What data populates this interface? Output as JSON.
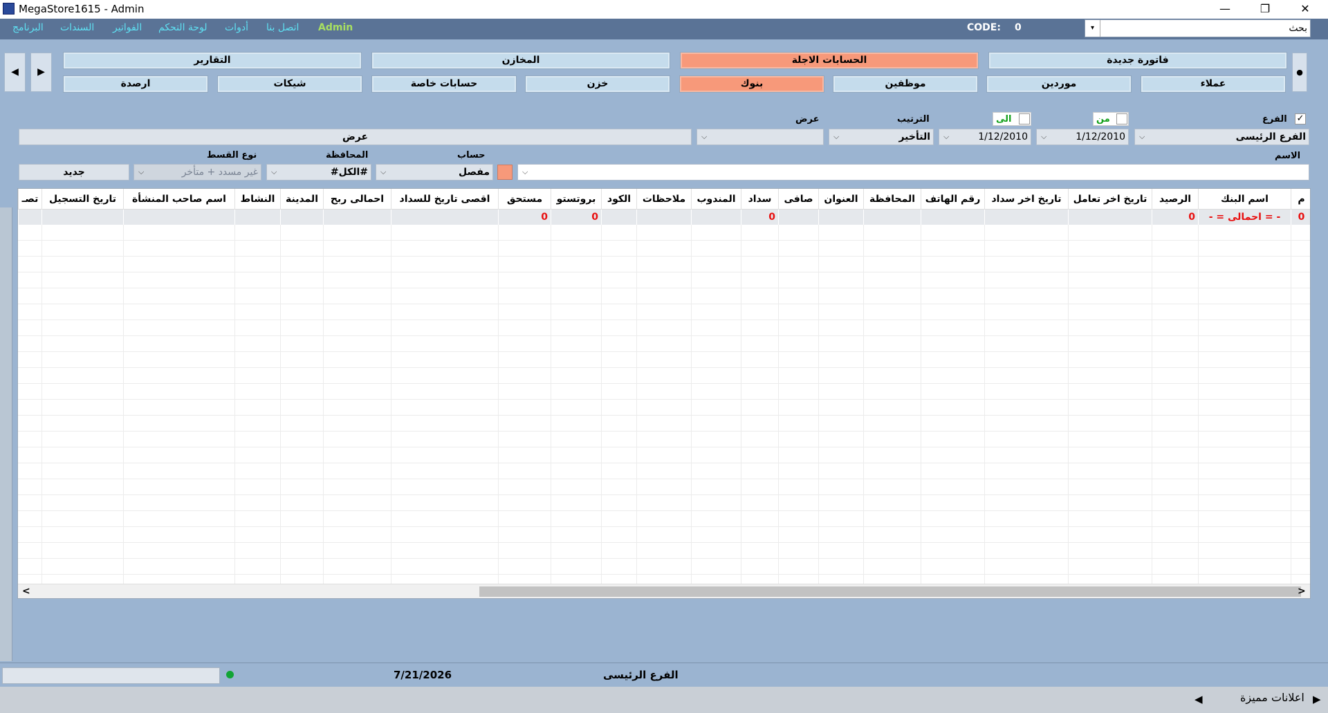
{
  "window": {
    "title": "MegaStore1615 - Admin",
    "min": "—",
    "restore": "❐",
    "close": "✕"
  },
  "menu": [
    "البرنامج",
    "السندات",
    "الفواتير",
    "لوحة التحكم",
    "أدوات",
    "اتصل بنا",
    "Admin"
  ],
  "code": {
    "label": "CODE:",
    "value": "0"
  },
  "search": {
    "text": "بحث",
    "arrow": "▾"
  },
  "nav": {
    "prev": "◀",
    "next": "▶",
    "dot": "●",
    "row1": [
      "فاتورة جديدة",
      "الحسابات الاجلة",
      "المخازن",
      "التقارير"
    ],
    "row2": [
      "عملاء",
      "موردين",
      "موظفين",
      "بنوك",
      "خزن",
      "حسابات خاصة",
      "شيكات",
      "ارصدة"
    ]
  },
  "filters": {
    "branch_label": "الفرع",
    "branch_checked": "✓",
    "branch_value": "الفرع الرئيسى",
    "from_label": "من",
    "to_label": "الى",
    "from_date": "1/12/2010",
    "to_date": "1/12/2010",
    "sort_label": "الترتيب",
    "sort_value": "التأخير",
    "view_label": "عرض",
    "view_button": "عرض",
    "name_label": "الاسم",
    "account_label": "حساب",
    "account_value": "مفصل",
    "governorate_label": "المحافظة",
    "governorate_value": "#الكل#",
    "installment_label": "نوع القسط",
    "installment_value": "غير مسدد + متأخر",
    "new_button": "جديد",
    "dropdown_glyph": "⌵"
  },
  "table": {
    "columns": [
      "م",
      "اسم البنك",
      "الرصيد",
      "تاريخ اخر تعامل",
      "تاريخ اخر سداد",
      "رقم الهاتف",
      "المحافظة",
      "العنوان",
      "صافى",
      "سداد",
      "المندوب",
      "ملاحظات",
      "الكود",
      "بروتستو",
      "مستحق",
      "اقصى تاريخ للسداد",
      "احمالى ربح",
      "المدينة",
      "النشاط",
      "اسم صاحب المنشأة",
      "تاريخ التسجيل",
      "تصـ"
    ],
    "total_row": {
      "m": "0",
      "name": "- = احمالى = -",
      "balance": "0",
      "payment": "0",
      "protest": "0",
      "due": "0"
    },
    "scroll_left": "<",
    "scroll_right": ">"
  },
  "status": {
    "date": "7/21/2026",
    "branch": "الفرع الرئيسى"
  },
  "footer": {
    "ads": "اعلانات مميزة",
    "left_arrow": "◀",
    "right_arrow": "▶"
  }
}
